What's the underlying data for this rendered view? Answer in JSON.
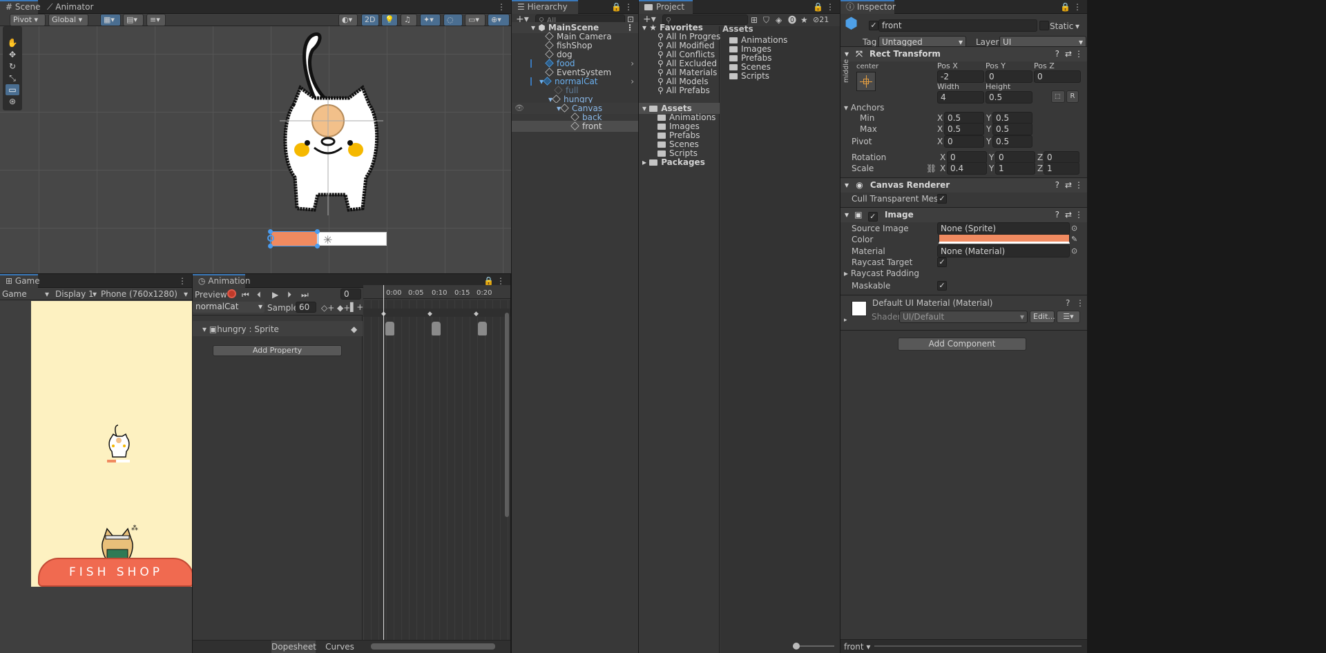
{
  "scene_panel": {
    "tabs": [
      "Scene",
      "Animator"
    ],
    "pivot": "Pivot",
    "global": "Global",
    "mode_2d": "2D"
  },
  "game_panel": {
    "tab": "Game",
    "mode": "Game",
    "display": "Display 1",
    "resolution": "Phone (760x1280)",
    "shop_sign": "FISH SHOP"
  },
  "animation_panel": {
    "tab": "Animation",
    "preview": "Preview",
    "frame": "0",
    "clip": "normalCat",
    "samples_label": "Samples",
    "samples": "60",
    "property": "hungry : Sprite",
    "add_property": "Add Property",
    "times": [
      "0:00",
      "0:05",
      "0:10",
      "0:15",
      "0:20"
    ],
    "dopesheet": "Dopesheet",
    "curves": "Curves"
  },
  "hierarchy": {
    "tab": "Hierarchy",
    "search_placeholder": "All",
    "items": [
      {
        "label": "MainScene",
        "kind": "scene"
      },
      {
        "label": "Main Camera",
        "kind": "obj"
      },
      {
        "label": "fishShop",
        "kind": "obj"
      },
      {
        "label": "dog",
        "kind": "obj"
      },
      {
        "label": "food",
        "kind": "prefab"
      },
      {
        "label": "EventSystem",
        "kind": "obj"
      },
      {
        "label": "normalCat",
        "kind": "prefab"
      },
      {
        "label": "full",
        "kind": "disabled"
      },
      {
        "label": "hungry",
        "kind": "prefab-child"
      },
      {
        "label": "Canvas",
        "kind": "prefab-child"
      },
      {
        "label": "back",
        "kind": "prefab-child"
      },
      {
        "label": "front",
        "kind": "selected"
      }
    ]
  },
  "project": {
    "tab": "Project",
    "hidden_count": "21",
    "favorites_label": "Favorites",
    "favorites": [
      "All In Progress",
      "All Modified",
      "All Conflicts",
      "All Excluded",
      "All Materials",
      "All Models",
      "All Prefabs"
    ],
    "assets_label": "Assets",
    "asset_folders": [
      "Animations",
      "Images",
      "Prefabs",
      "Scenes",
      "Scripts"
    ],
    "packages_label": "Packages",
    "breadcrumb": "Assets",
    "content": [
      "Animations",
      "Images",
      "Prefabs",
      "Scenes",
      "Scripts"
    ]
  },
  "inspector": {
    "tab": "Inspector",
    "name": "front",
    "static": "Static",
    "tag_label": "Tag",
    "tag": "Untagged",
    "layer_label": "Layer",
    "layer": "UI",
    "rect_transform": {
      "title": "Rect Transform",
      "anchor_h": "center",
      "anchor_v": "middle",
      "posx_label": "Pos X",
      "posx": "-2",
      "posy_label": "Pos Y",
      "posy": "0",
      "posz_label": "Pos Z",
      "posz": "0",
      "width_label": "Width",
      "width": "4",
      "height_label": "Height",
      "height": "0.5",
      "anchors": "Anchors",
      "min": "Min",
      "max": "Max",
      "min_x": "0.5",
      "min_y": "0.5",
      "max_x": "0.5",
      "max_y": "0.5",
      "pivot": "Pivot",
      "pivot_x": "0",
      "pivot_y": "0.5",
      "rotation": "Rotation",
      "rot_x": "0",
      "rot_y": "0",
      "rot_z": "0",
      "scale": "Scale",
      "scale_x": "0.4",
      "scale_y": "1",
      "scale_z": "1",
      "x": "X",
      "y": "Y",
      "z": "Z",
      "r": "R"
    },
    "canvas_renderer": {
      "title": "Canvas Renderer",
      "cull": "Cull Transparent Mesh"
    },
    "image": {
      "title": "Image",
      "source_label": "Source Image",
      "source": "None (Sprite)",
      "color_label": "Color",
      "color": "#f08a60",
      "material_label": "Material",
      "material": "None (Material)",
      "raycast_target": "Raycast Target",
      "raycast_padding": "Raycast Padding",
      "maskable": "Maskable"
    },
    "material": {
      "name": "Default UI Material (Material)",
      "shader_label": "Shader",
      "shader": "UI/Default",
      "edit": "Edit..."
    },
    "add_component": "Add Component",
    "footer": "front"
  }
}
